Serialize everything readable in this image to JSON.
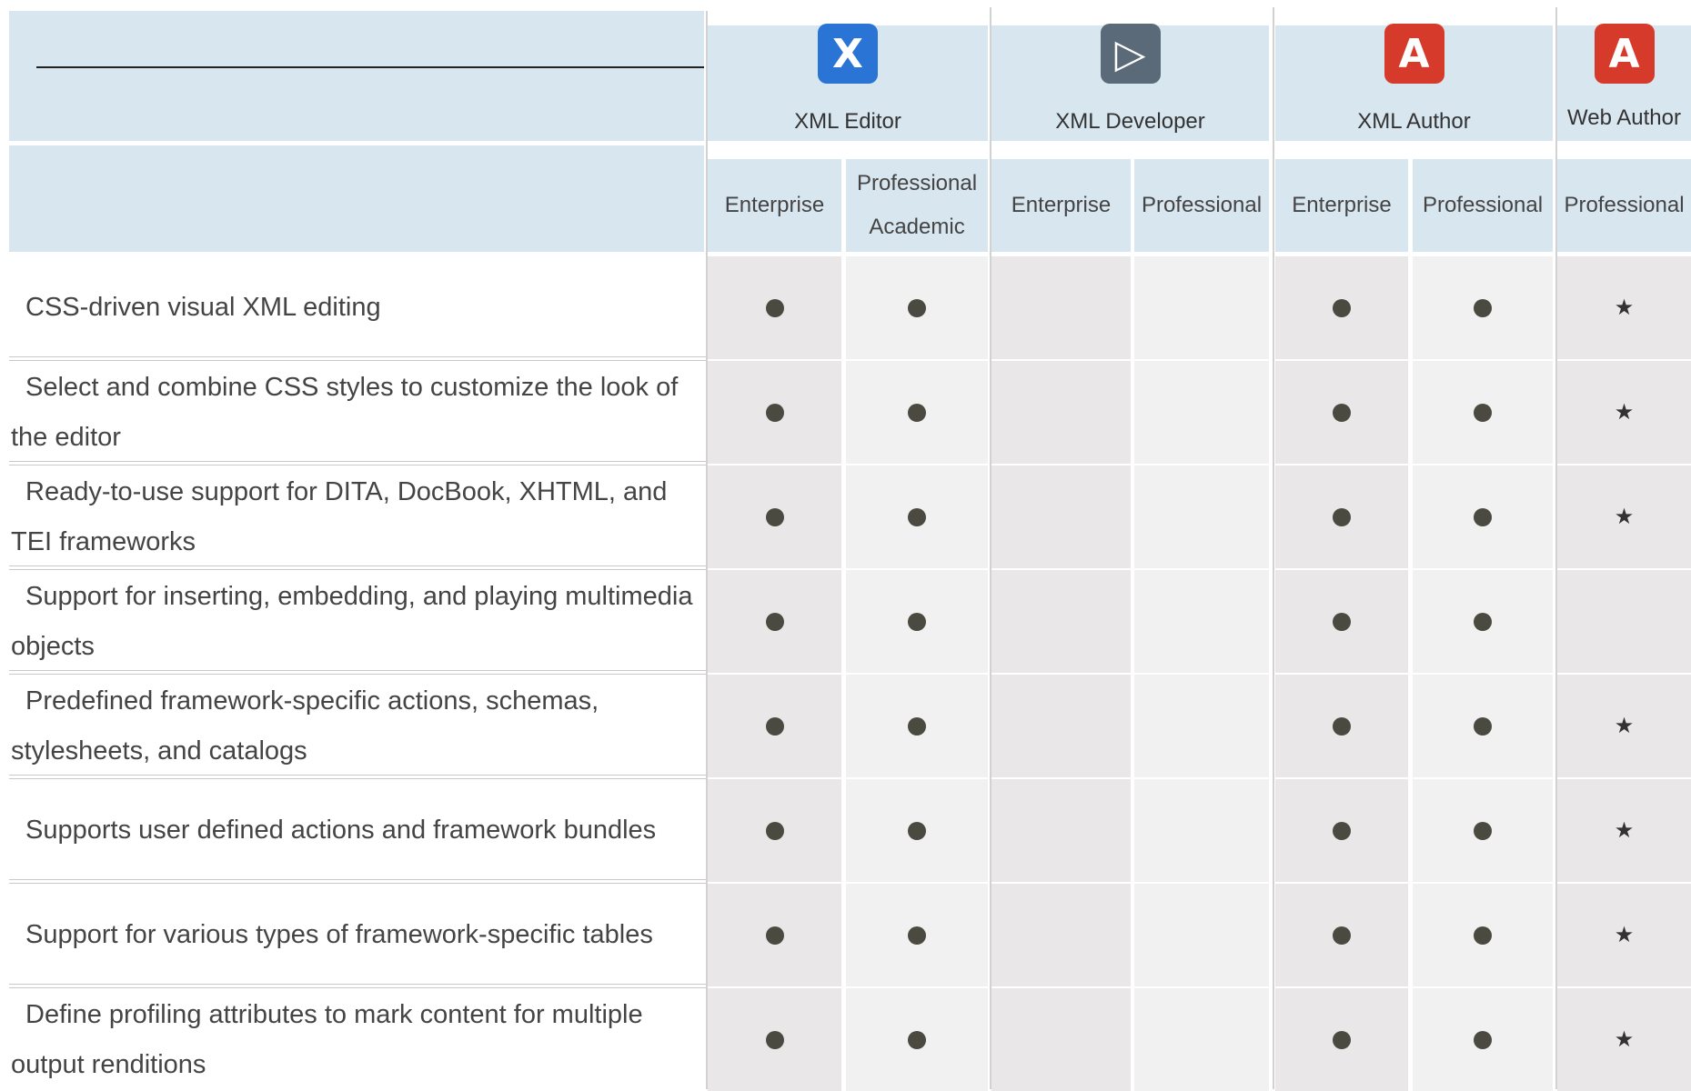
{
  "products": [
    {
      "name": "XML Editor",
      "icon": "oxygen-xml-editor-icon",
      "color": "#2a74d5",
      "editions": [
        "Enterprise",
        "Professional\nAcademic"
      ]
    },
    {
      "name": "XML Developer",
      "icon": "oxygen-xml-developer-icon",
      "color": "#5b6a78",
      "editions": [
        "Enterprise",
        "Professional"
      ]
    },
    {
      "name": "XML Author",
      "icon": "oxygen-xml-author-icon",
      "color": "#d53a2a",
      "editions": [
        "Enterprise",
        "Professional"
      ]
    },
    {
      "name": "Web Author",
      "icon": "oxygen-web-author-icon",
      "color": "#d53a2a",
      "editions": [
        "Professional"
      ]
    }
  ],
  "features": [
    {
      "label": "CSS-driven visual XML editing",
      "marks": [
        "dot",
        "dot",
        "",
        "",
        "dot",
        "dot",
        "star"
      ]
    },
    {
      "label": "Select and combine CSS styles to customize the look of the editor",
      "marks": [
        "dot",
        "dot",
        "",
        "",
        "dot",
        "dot",
        "star"
      ]
    },
    {
      "label": "Ready-to-use support for DITA, DocBook, XHTML, and TEI frameworks",
      "marks": [
        "dot",
        "dot",
        "",
        "",
        "dot",
        "dot",
        "star"
      ]
    },
    {
      "label": "Support for inserting, embedding, and playing multimedia objects",
      "marks": [
        "dot",
        "dot",
        "",
        "",
        "dot",
        "dot",
        ""
      ]
    },
    {
      "label": "Predefined framework-specific actions, schemas, stylesheets, and catalogs",
      "marks": [
        "dot",
        "dot",
        "",
        "",
        "dot",
        "dot",
        "star"
      ]
    },
    {
      "label": "Supports user defined actions and framework bundles",
      "marks": [
        "dot",
        "dot",
        "",
        "",
        "dot",
        "dot",
        "star"
      ]
    },
    {
      "label": "Support for various types of framework-specific tables",
      "marks": [
        "dot",
        "dot",
        "",
        "",
        "dot",
        "dot",
        "star"
      ]
    },
    {
      "label": "Define profiling attributes to mark content for multiple output renditions",
      "marks": [
        "dot",
        "dot",
        "",
        "",
        "dot",
        "dot",
        "star"
      ]
    }
  ],
  "colors": {
    "header_bg": "#d8e6ef",
    "cell_gray": "#e9e7e7",
    "cell_light": "#f2f1f1",
    "mark": "#4a4a40"
  }
}
